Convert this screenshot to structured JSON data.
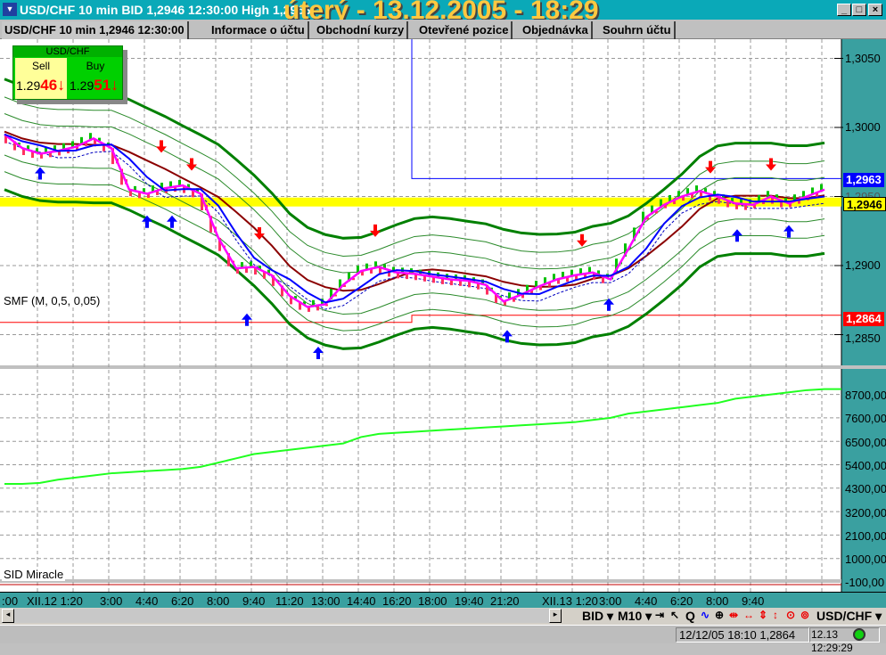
{
  "window": {
    "title": "USD/CHF 10 min BID 1,2946 12:30:00 High 1,2963",
    "overlay_date": "úterý - 13.12.2005 - 18:29",
    "logo": "SID"
  },
  "tabs": [
    {
      "label": "USD/CHF 10 min 1,2946 12:30:00"
    },
    {
      "label": "Informace o účtu"
    },
    {
      "label": "Obchodní kurzy"
    },
    {
      "label": "Otevřené pozice"
    },
    {
      "label": "Objednávka"
    },
    {
      "label": "Souhrn účtu"
    }
  ],
  "quote": {
    "symbol": "USD/CHF",
    "sell_label": "Sell",
    "sell_prefix": "1.29",
    "sell_suffix": "46",
    "buy_label": "Buy",
    "buy_prefix": "1.29",
    "buy_suffix": "51",
    "arrow": "↓"
  },
  "panels": {
    "price_label": "SMF (M, 0,5, 0,05)",
    "indicator_label": "SID Miracle"
  },
  "price_tags": {
    "high": "1,2963",
    "current": "1,2946",
    "low": "1,2864"
  },
  "price_axis": [
    "1,3050",
    "1,3000",
    "1,2950",
    "1,2900",
    "1,2850"
  ],
  "indicator_axis": [
    "8700,00",
    "7600,00",
    "6500,00",
    "5400,00",
    "4300,00",
    "3200,00",
    "2100,00",
    "1000,00",
    "-100,00"
  ],
  "time_axis": [
    ":00",
    "XII.12 1:20",
    "3:00",
    "4:40",
    "6:20",
    "8:00",
    "9:40",
    "11:20",
    "13:00",
    "14:40",
    "16:20",
    "18:00",
    "19:40",
    "21:20",
    "XII.13 1:20",
    "3:00",
    "4:40",
    "6:20",
    "8:00",
    "9:40"
  ],
  "toolbar": {
    "bid": "BID ▾",
    "timeframe": "M10 ▾",
    "q": "Q",
    "symbol": "USD/CHF ▾"
  },
  "status": {
    "last_bar": "12/12/05 18:10  1,2864",
    "clock": "12.13 12:29:29"
  },
  "chart_data": {
    "type": "line",
    "price_series": [
      1.2995,
      1.2985,
      1.2981,
      1.2983,
      1.2986,
      1.2992,
      1.2985,
      1.2955,
      1.2952,
      1.2956,
      1.2958,
      1.2952,
      1.292,
      1.2898,
      1.2899,
      1.2893,
      1.2878,
      1.287,
      1.2872,
      1.2886,
      1.2896,
      1.2899,
      1.2895,
      1.2894,
      1.2892,
      1.289,
      1.2889,
      1.2886,
      1.2874,
      1.2879,
      1.2885,
      1.289,
      1.2893,
      1.2895,
      1.289,
      1.2912,
      1.2935,
      1.2944,
      1.295,
      1.2954,
      1.295,
      1.2945,
      1.2944,
      1.295,
      1.2945,
      1.295,
      1.2955
    ],
    "indicator_series": [
      4500,
      4500,
      4550,
      4700,
      4800,
      4900,
      5000,
      5050,
      5100,
      5150,
      5200,
      5300,
      5500,
      5700,
      5900,
      6000,
      6100,
      6200,
      6300,
      6400,
      6700,
      6850,
      6900,
      6950,
      7000,
      7050,
      7100,
      7150,
      7200,
      7250,
      7300,
      7350,
      7400,
      7500,
      7600,
      7800,
      7900,
      8000,
      8100,
      8200,
      8300,
      8500,
      8600,
      8700,
      8800,
      8900,
      8950
    ],
    "sell_signals": [
      [
        8.8,
        1.2983
      ],
      [
        10.5,
        1.297
      ],
      [
        14.3,
        1.292
      ],
      [
        20.8,
        1.2922
      ],
      [
        32.4,
        1.2915
      ],
      [
        39.6,
        1.2968
      ],
      [
        43,
        1.297
      ]
    ],
    "buy_signals": [
      [
        2,
        1.297
      ],
      [
        8,
        1.2935
      ],
      [
        9.4,
        1.2935
      ],
      [
        13.6,
        1.2864
      ],
      [
        17.6,
        1.284
      ],
      [
        28.2,
        1.2852
      ],
      [
        33.9,
        1.2875
      ],
      [
        41.1,
        1.2925
      ],
      [
        44,
        1.2928
      ]
    ],
    "high_line": 1.2963,
    "current_line": 1.2946,
    "low_line": 1.2864,
    "price_range": [
      1.2825,
      1.3075
    ],
    "indicator_range": [
      -100,
      9500
    ]
  }
}
